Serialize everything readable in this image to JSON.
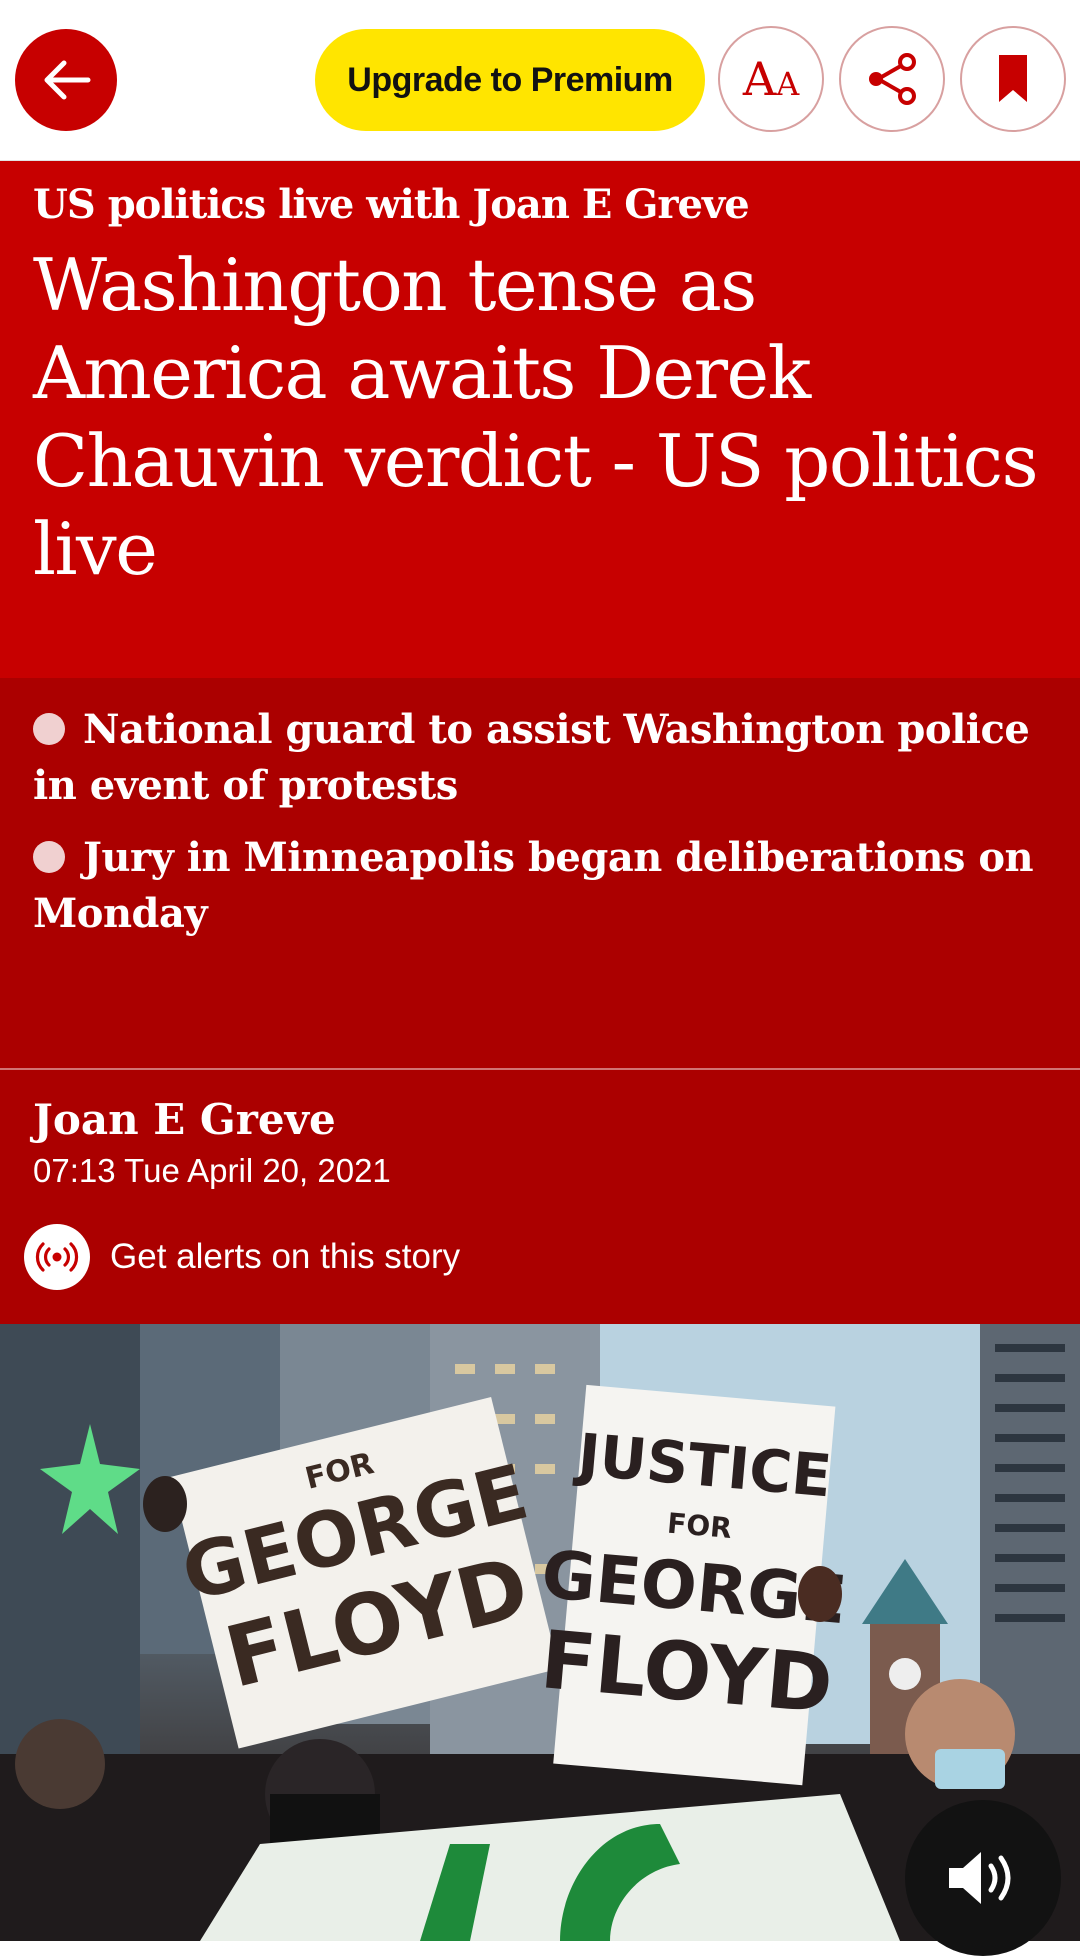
{
  "toolbar": {
    "premium_label": "Upgrade to Premium",
    "back_icon": "arrow-left-icon",
    "font_icon": "text-size-icon",
    "share_icon": "share-icon",
    "bookmark_icon": "bookmark-icon"
  },
  "article": {
    "kicker": "US politics live with Joan E Greve",
    "headline": "Washington tense as America awaits Derek Chauvin verdict - US politics live",
    "bullets": [
      "National guard to assist Washington police in event of protests",
      "Jury in Minneapolis began deliberations on Monday"
    ],
    "author": "Joan E Greve",
    "timestamp": "07:13 Tue April 20, 2021",
    "alerts_label": "Get alerts on this story"
  },
  "hero_image": {
    "sign_left_top": "FOR",
    "sign_left_line1": "GEORGE",
    "sign_left_line2": "FLOYD",
    "sign_right_line1": "JUSTICE",
    "sign_right_line2": "FOR",
    "sign_right_line3": "GEORGE",
    "sign_right_line4": "FLOYD"
  },
  "colors": {
    "brand_red": "#c70000",
    "dark_red": "#ab0000",
    "premium_yellow": "#ffe500"
  }
}
